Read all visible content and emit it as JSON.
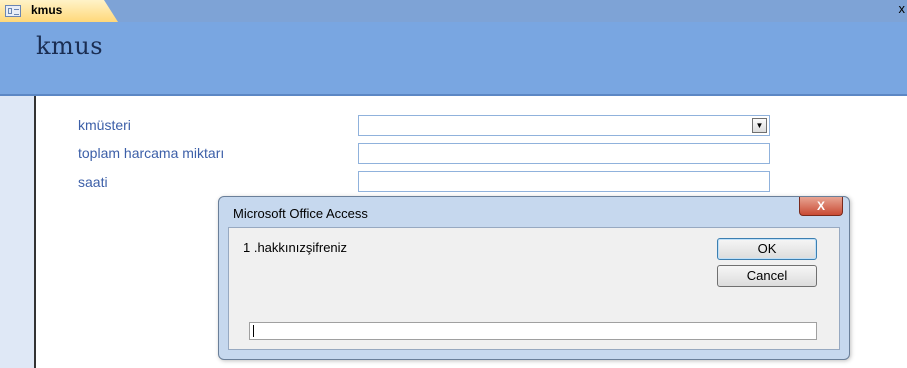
{
  "tab": {
    "label": "kmus",
    "icon": "form-icon",
    "close_glyph": "x"
  },
  "form": {
    "title": "kmus",
    "fields": [
      {
        "label": "kmüsteri",
        "value": "",
        "type": "combobox"
      },
      {
        "label": "toplam harcama miktarı",
        "value": "",
        "type": "text"
      },
      {
        "label": "saati",
        "value": "",
        "type": "text"
      }
    ]
  },
  "dialog": {
    "title": "Microsoft Office Access",
    "close_glyph": "X",
    "prompt": "1 .hakkınızşifreniz",
    "ok_label": "OK",
    "cancel_label": "Cancel",
    "input_value": ""
  },
  "colors": {
    "header_bg": "#79a6e1",
    "title_color": "#1a2d52",
    "label_color": "#3c5fa8",
    "field_border": "#90b2dc",
    "close_button": "#c94b34"
  }
}
